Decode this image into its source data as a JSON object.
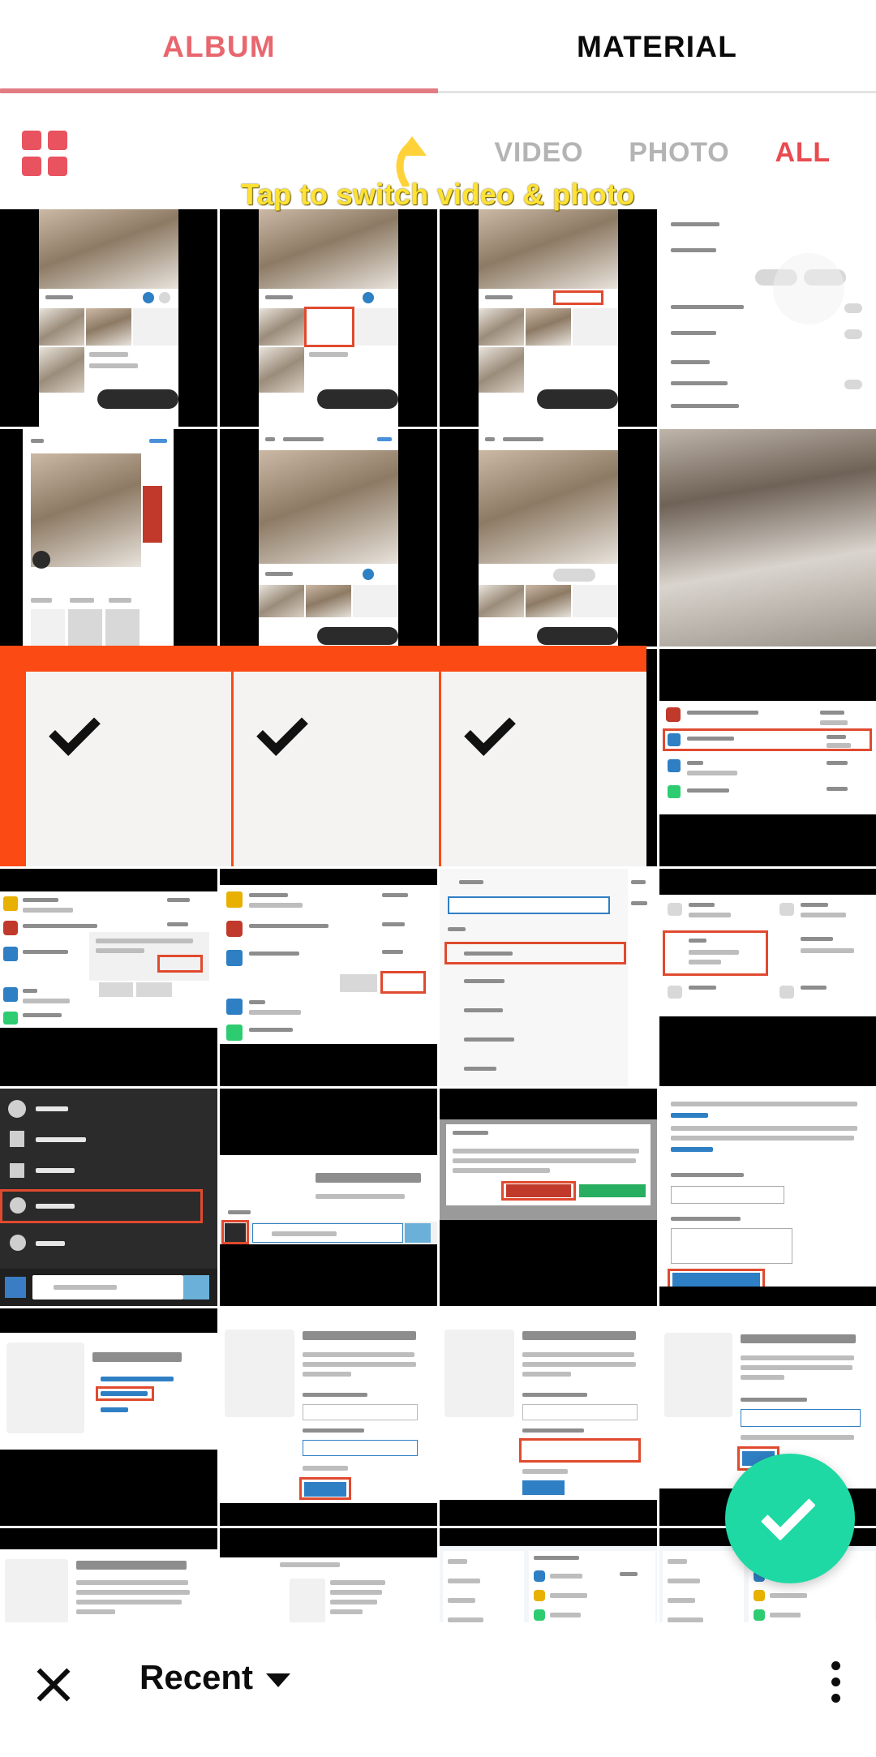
{
  "top_tabs": [
    {
      "label": "ALBUM",
      "active": true
    },
    {
      "label": "MATERIAL",
      "active": false
    }
  ],
  "toolbar": {
    "grid_icon": "grid-icon",
    "filters": [
      {
        "label": "VIDEO",
        "active": false
      },
      {
        "label": "PHOTO",
        "active": false
      },
      {
        "label": "ALL",
        "active": true
      }
    ]
  },
  "hint": {
    "text": "Tap to switch video & photo",
    "arrow_icon": "curved-up-arrow-icon",
    "color": "#FFE234"
  },
  "selection": {
    "frame_color": "#FB4A14",
    "selected_count": 3,
    "check_icon": "checkmark-icon"
  },
  "fab": {
    "icon": "check-icon",
    "color": "#1FD9A4",
    "label": "Confirm"
  },
  "bottom_bar": {
    "close_icon": "close-icon",
    "folder_label": "Recent",
    "dropdown_icon": "chevron-down-icon",
    "overflow_icon": "more-vertical-icon"
  },
  "colors": {
    "accent_red": "#E8676F",
    "filter_active": "#E84B50",
    "grid_icon": "#E8535F",
    "selection_orange": "#FB4A14",
    "fab_green": "#1FD9A4",
    "hint_yellow": "#FFE234"
  },
  "grid": {
    "columns": 4,
    "rows": [
      {
        "cells": [
          {
            "kind": "instagram-new-post",
            "selected": false
          },
          {
            "kind": "instagram-new-post",
            "selected": false
          },
          {
            "kind": "instagram-new-post",
            "selected": false
          },
          {
            "kind": "instagram-advanced-settings",
            "selected": false
          }
        ]
      },
      {
        "cells": [
          {
            "kind": "instagram-filter-screen",
            "selected": false
          },
          {
            "kind": "instagram-new-post",
            "selected": false
          },
          {
            "kind": "instagram-new-post",
            "selected": false
          },
          {
            "kind": "puppy-photo",
            "selected": false
          }
        ]
      },
      {
        "cells": [
          {
            "kind": "puppy-photo",
            "selected": true
          },
          {
            "kind": "puppy-photo",
            "selected": true
          },
          {
            "kind": "puppy-photo",
            "selected": true
          },
          {
            "kind": "windows-apps-list",
            "selected": false
          }
        ]
      },
      {
        "cells": [
          {
            "kind": "windows-uninstall-dialog",
            "selected": false
          },
          {
            "kind": "windows-uninstall-dialog",
            "selected": false
          },
          {
            "kind": "windows-settings-apps",
            "selected": false
          },
          {
            "kind": "windows-settings-home",
            "selected": false
          }
        ]
      },
      {
        "cells": [
          {
            "kind": "windows-start-menu",
            "selected": false
          },
          {
            "kind": "windows-taskbar-search",
            "selected": false
          },
          {
            "kind": "telegram-confirm-dialog",
            "selected": false
          },
          {
            "kind": "telegram-delete-account",
            "selected": false
          }
        ]
      },
      {
        "cells": [
          {
            "kind": "telegram-core-page",
            "selected": false
          },
          {
            "kind": "telegram-login-form",
            "selected": false
          },
          {
            "kind": "telegram-confirmation-code",
            "selected": false
          },
          {
            "kind": "telegram-phone-form",
            "selected": false
          }
        ]
      },
      {
        "cells": [
          {
            "kind": "telegram-phone-entry",
            "selected": false
          },
          {
            "kind": "telegram-page-small",
            "selected": false
          },
          {
            "kind": "windows-apps-settings",
            "selected": false
          },
          {
            "kind": "windows-apps-settings",
            "selected": false
          }
        ]
      }
    ]
  }
}
